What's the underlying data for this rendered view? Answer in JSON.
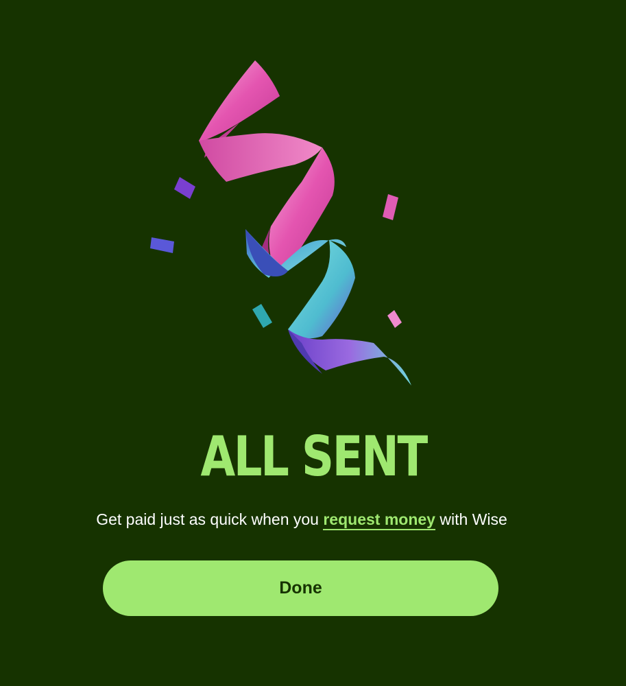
{
  "confirmation": {
    "title": "ALL SENT",
    "subtitle_before": "Get paid just as quick when you ",
    "subtitle_link": "request money",
    "subtitle_after": " with Wise"
  },
  "actions": {
    "done_label": "Done"
  },
  "illustration": {
    "icon": "celebration-ribbon-icon"
  },
  "colors": {
    "background": "#163300",
    "accent": "#9fe870",
    "text": "#ffffff"
  }
}
